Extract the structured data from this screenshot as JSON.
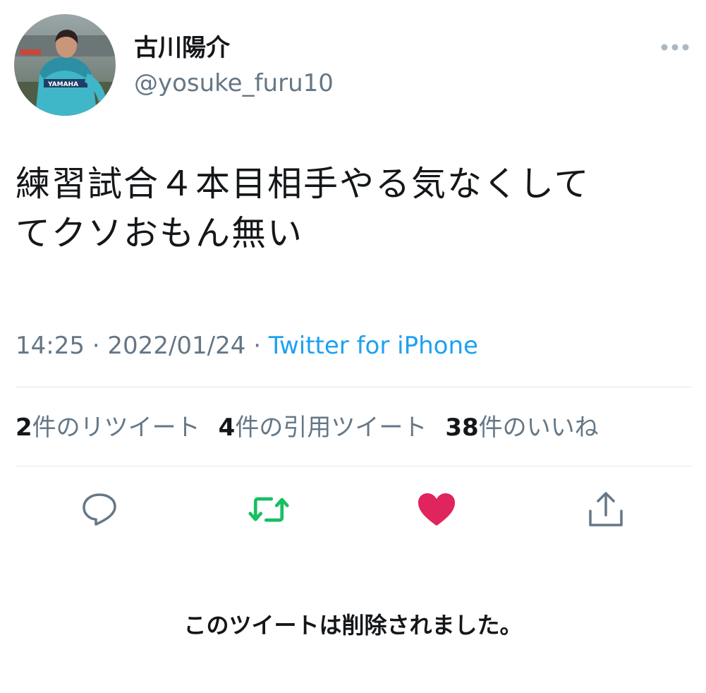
{
  "author": {
    "display_name": "古川陽介",
    "handle": "@yosuke_furu10",
    "avatar_shirt_text": "YAMAHA"
  },
  "tweet": {
    "text_line1": "練習試合４本目相手やる気なくして",
    "text_line2": "てクソおもん無い",
    "time": "14:25",
    "date": "2022/01/24",
    "separator": " · ",
    "source": "Twitter for iPhone"
  },
  "stats": {
    "retweets_count": "2",
    "retweets_label": "件のリツイート",
    "quotes_count": "4",
    "quotes_label": "件の引用ツイート",
    "likes_count": "38",
    "likes_label": "件のいいね"
  },
  "actions": {
    "reply_icon": "reply-icon",
    "retweet_icon": "retweet-icon",
    "like_icon": "heart-icon",
    "share_icon": "share-icon"
  },
  "colors": {
    "retweet_active": "#17bf63",
    "like_active": "#e0245e",
    "link": "#1da1f2",
    "secondary_text": "#657786"
  },
  "notice": {
    "deleted_text": "このツイートは削除されました。"
  }
}
